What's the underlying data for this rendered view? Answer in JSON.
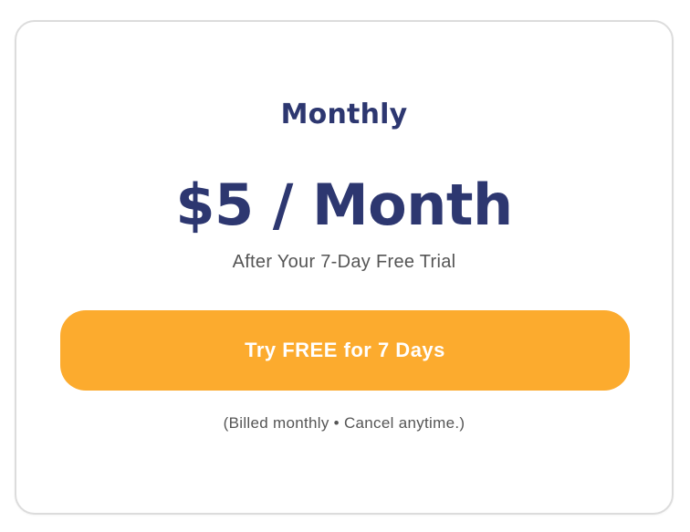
{
  "plan": {
    "title": "Monthly",
    "price": "$5 / Month",
    "trial_note": "After Your 7-Day Free Trial",
    "cta_label": "Try FREE for 7 Days",
    "billing_note": "(Billed monthly • Cancel anytime.)"
  },
  "colors": {
    "primary_text": "#2d3770",
    "cta_background": "#fcab2e",
    "cta_text": "#ffffff",
    "muted_text": "#555555",
    "card_border": "#dcdcdc"
  }
}
